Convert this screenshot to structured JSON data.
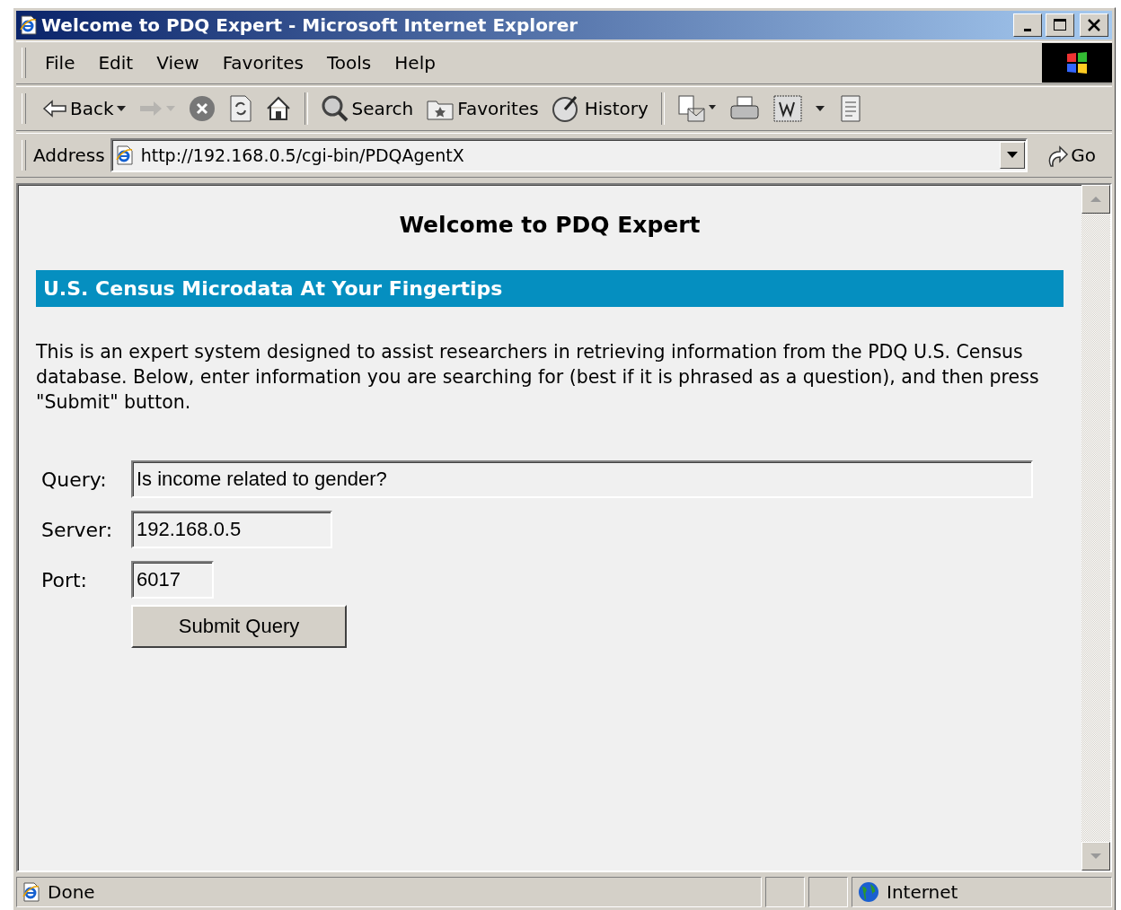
{
  "window": {
    "title": "Welcome to PDQ Expert - Microsoft Internet Explorer"
  },
  "menu": [
    "File",
    "Edit",
    "View",
    "Favorites",
    "Tools",
    "Help"
  ],
  "toolbar": [
    {
      "kind": "back",
      "label": "Back",
      "disabled": false
    },
    {
      "kind": "forward",
      "disabled": true
    },
    {
      "kind": "stop",
      "disabled": false
    },
    {
      "kind": "refresh",
      "disabled": false
    },
    {
      "kind": "home",
      "disabled": false
    },
    {
      "kind": "separator",
      "disabled": false
    },
    {
      "kind": "search",
      "label": "Search",
      "disabled": false
    },
    {
      "kind": "favorites",
      "label": "Favorites",
      "disabled": false
    },
    {
      "kind": "history",
      "label": "History",
      "disabled": false
    },
    {
      "kind": "separator",
      "disabled": false
    },
    {
      "kind": "mail",
      "disabled": false
    },
    {
      "kind": "print",
      "disabled": false
    },
    {
      "kind": "edit",
      "disabled": false
    },
    {
      "kind": "discuss",
      "disabled": false
    }
  ],
  "address": {
    "label": "Address",
    "url": "http://192.168.0.5/cgi-bin/PDQAgentX",
    "go": "Go"
  },
  "page": {
    "heading": "Welcome to PDQ Expert",
    "banner": "U.S. Census Microdata At Your Fingertips",
    "intro": "This is an expert system designed to assist researchers in retrieving information from the PDQ U.S. Census database. Below, enter information you are searching for (best if it is phrased as a question), and then press \"Submit\" button.",
    "fields": [
      {
        "label": "Query:",
        "value": "Is income related to gender?",
        "kind": "long"
      },
      {
        "label": "Server:",
        "value": "192.168.0.5",
        "kind": "medium"
      },
      {
        "label": "Port:",
        "value": "6017",
        "kind": "short"
      }
    ],
    "submit": "Submit Query"
  },
  "status_bar": {
    "text": "Done",
    "zone": "Internet"
  }
}
